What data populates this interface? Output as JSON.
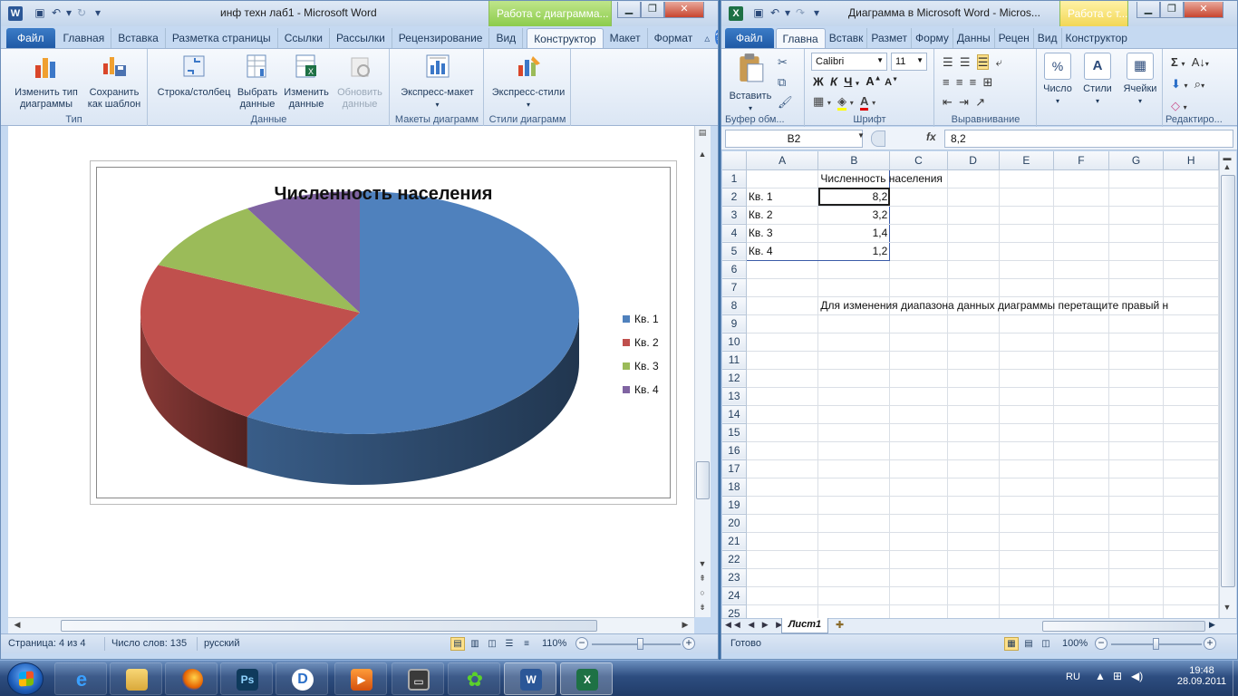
{
  "word": {
    "title": "инф техн лаб1  -  Microsoft Word",
    "context_header": "Работа с диаграмма...",
    "tabs": [
      {
        "label": "Файл"
      },
      {
        "label": "Главная"
      },
      {
        "label": "Вставка"
      },
      {
        "label": "Разметка страницы"
      },
      {
        "label": "Ссылки"
      },
      {
        "label": "Рассылки"
      },
      {
        "label": "Рецензирование"
      },
      {
        "label": "Вид"
      },
      {
        "label": "Конструктор"
      },
      {
        "label": "Макет"
      },
      {
        "label": "Формат"
      }
    ],
    "ribbon": {
      "change_type": "Изменить тип\nдиаграммы",
      "save_template": "Сохранить\nкак шаблон",
      "group_type": "Тип",
      "row_col": "Строка/столбец",
      "select_data": "Выбрать\nданные",
      "edit_data": "Изменить\nданные",
      "refresh_data": "Обновить\nданные",
      "group_data": "Данные",
      "quick_layout": "Экспресс-макет",
      "group_layouts": "Макеты диаграмм",
      "quick_styles": "Экспресс-стили",
      "group_styles": "Стили диаграмм"
    },
    "status": {
      "page": "Страница: 4 из 4",
      "words": "Число слов: 135",
      "lang": "русский",
      "zoom": "110%",
      "zoom_fraction": 0.55
    }
  },
  "chart_data": {
    "type": "pie",
    "title": "Численность населения",
    "categories": [
      "Кв. 1",
      "Кв. 2",
      "Кв. 3",
      "Кв. 4"
    ],
    "values": [
      8.2,
      3.2,
      1.4,
      1.2
    ],
    "colors": [
      "#4f81bd",
      "#c0504d",
      "#9bbb59",
      "#8064a2"
    ],
    "legend": "right",
    "style": "3d"
  },
  "excel": {
    "title": "Диаграмма в Microsoft Word  -  Micros...",
    "context_header": "Работа с т...",
    "tabs": [
      {
        "label": "Файл"
      },
      {
        "label": "Главна"
      },
      {
        "label": "Вставк"
      },
      {
        "label": "Размет"
      },
      {
        "label": "Форму"
      },
      {
        "label": "Данны"
      },
      {
        "label": "Рецен"
      },
      {
        "label": "Вид"
      },
      {
        "label": "Конструктор"
      }
    ],
    "ribbon": {
      "paste": "Вставить",
      "group_clipboard": "Буфер обм...",
      "font_name": "Calibri",
      "font_size": "11",
      "group_font": "Шрифт",
      "group_align": "Выравнивание",
      "number": "Число",
      "styles": "Стили",
      "cells": "Ячейки",
      "group_edit": "Редактиро..."
    },
    "name_box": "B2",
    "fx": "fx",
    "formula": "8,2",
    "columns": [
      "A",
      "B",
      "C",
      "D",
      "E",
      "F",
      "G",
      "H"
    ],
    "rows": [
      {
        "n": "1",
        "a": "",
        "b": "Численность населения"
      },
      {
        "n": "2",
        "a": "Кв. 1",
        "b": "8,2"
      },
      {
        "n": "3",
        "a": "Кв. 2",
        "b": "3,2"
      },
      {
        "n": "4",
        "a": "Кв. 3",
        "b": "1,4"
      },
      {
        "n": "5",
        "a": "Кв. 4",
        "b": "1,2"
      },
      {
        "n": "6",
        "a": "",
        "b": ""
      },
      {
        "n": "7",
        "a": "",
        "b": ""
      },
      {
        "n": "8",
        "a": "",
        "b": "Для изменения диапазона данных диаграммы перетащите правый н"
      },
      {
        "n": "9",
        "a": "",
        "b": ""
      },
      {
        "n": "10",
        "a": "",
        "b": ""
      },
      {
        "n": "11",
        "a": "",
        "b": ""
      },
      {
        "n": "12",
        "a": "",
        "b": ""
      },
      {
        "n": "13",
        "a": "",
        "b": ""
      },
      {
        "n": "14",
        "a": "",
        "b": ""
      },
      {
        "n": "15",
        "a": "",
        "b": ""
      },
      {
        "n": "16",
        "a": "",
        "b": ""
      },
      {
        "n": "17",
        "a": "",
        "b": ""
      },
      {
        "n": "18",
        "a": "",
        "b": ""
      },
      {
        "n": "19",
        "a": "",
        "b": ""
      },
      {
        "n": "20",
        "a": "",
        "b": ""
      },
      {
        "n": "21",
        "a": "",
        "b": ""
      },
      {
        "n": "22",
        "a": "",
        "b": ""
      },
      {
        "n": "23",
        "a": "",
        "b": ""
      },
      {
        "n": "24",
        "a": "",
        "b": ""
      },
      {
        "n": "25",
        "a": "",
        "b": ""
      }
    ],
    "sheet_tab": "Лист1",
    "status": {
      "ready": "Готово",
      "zoom": "100%",
      "zoom_fraction": 0.5
    }
  },
  "taskbar": {
    "apps": [
      "start",
      "internet-explorer",
      "file-explorer",
      "firefox",
      "photoshop",
      "daemon-tools",
      "media-player",
      "film-reel",
      "icq",
      "word",
      "excel"
    ],
    "lang": "RU",
    "time": "19:48",
    "date": "28.09.2011"
  }
}
